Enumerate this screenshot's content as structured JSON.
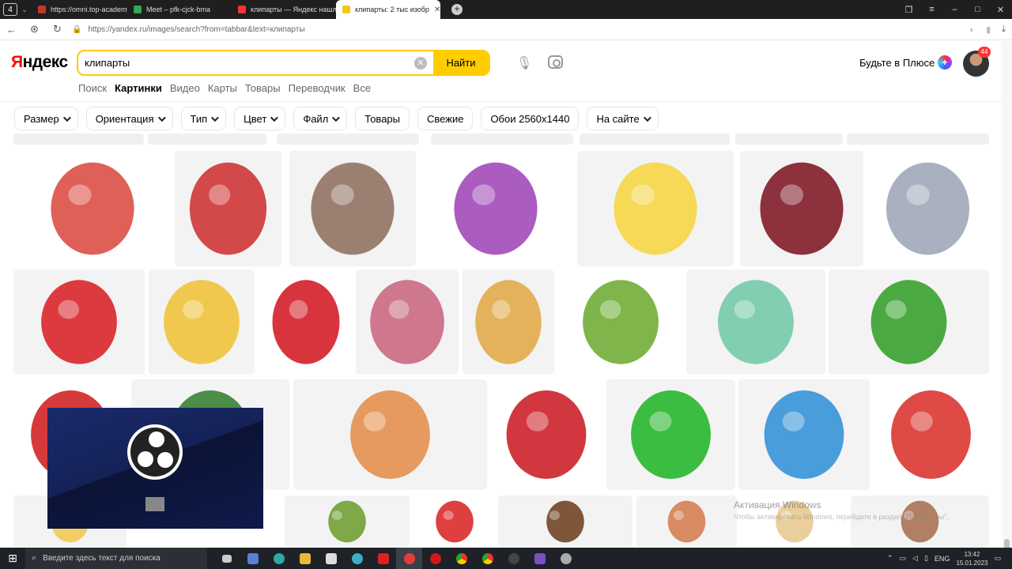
{
  "browser": {
    "tab_count": "4",
    "tabs": [
      {
        "title": "https://omni.top-academy",
        "favicon_color": "#c0392b"
      },
      {
        "title": "Meet – pfk-cjck-bma",
        "favicon_color": "#34a853"
      },
      {
        "title": "клипарты — Яндекс нашл",
        "favicon_color": "#ff3333"
      },
      {
        "title": "клипарты: 2 тыс изобр",
        "favicon_color": "#f5c518"
      }
    ],
    "url": "https://yandex.ru/images/search?from=tabbar&text=клипарты"
  },
  "header": {
    "logo_y": "Я",
    "logo_rest": "ндекс",
    "search_value": "клипарты",
    "search_button": "Найти",
    "plus_label": "Будьте в Плюсе",
    "notifications": "44"
  },
  "services": [
    "Поиск",
    "Картинки",
    "Видео",
    "Карты",
    "Товары",
    "Переводчик",
    "Все"
  ],
  "filters": [
    {
      "label": "Размер",
      "dropdown": true
    },
    {
      "label": "Ориентация",
      "dropdown": true
    },
    {
      "label": "Тип",
      "dropdown": true
    },
    {
      "label": "Цвет",
      "dropdown": true
    },
    {
      "label": "Файл",
      "dropdown": true
    },
    {
      "label": "Товары",
      "dropdown": false
    },
    {
      "label": "Свежие",
      "dropdown": false
    },
    {
      "label": "Обои 2560x1440",
      "dropdown": false
    },
    {
      "label": "На сайте",
      "dropdown": true
    }
  ],
  "images": [
    {
      "subject": "cartoon-characters-collage",
      "main_color": "#d9443a"
    },
    {
      "subject": "ice-skate-with-bow",
      "main_color": "#cc2a2a"
    },
    {
      "subject": "woman-with-flowers",
      "main_color": "#8b6b5a"
    },
    {
      "subject": "woman-in-purple-dress",
      "main_color": "#9b3fb5"
    },
    {
      "subject": "cartoon-kids-boy-and-girl",
      "main_color": "#f6d43a"
    },
    {
      "subject": "cherry",
      "main_color": "#7a0e1c"
    },
    {
      "subject": "cartoon-donkey",
      "main_color": "#9aa3b5"
    },
    {
      "subject": "red-handbag",
      "main_color": "#d8191f"
    },
    {
      "subject": "daisies",
      "main_color": "#f0c030"
    },
    {
      "subject": "red-carnations",
      "main_color": "#d0101c"
    },
    {
      "subject": "heart-of-sweets",
      "main_color": "#c7607a"
    },
    {
      "subject": "girl-with-suitcase",
      "main_color": "#e0a640"
    },
    {
      "subject": "green-sprout-with-butterfly",
      "main_color": "#69a82c"
    },
    {
      "subject": "woman-in-green-dress",
      "main_color": "#6cc7a5"
    },
    {
      "subject": "green-gift-box",
      "main_color": "#2d9b22"
    },
    {
      "subject": "red-circle",
      "main_color": "#d01818"
    },
    {
      "subject": "flower-branch",
      "main_color": "#2d7a2a"
    },
    {
      "subject": "woman-with-children",
      "main_color": "#e48a44"
    },
    {
      "subject": "white-figure-with-question-mark",
      "main_color": "#c9141c"
    },
    {
      "subject": "green-check-mark",
      "main_color": "#1ab321"
    },
    {
      "subject": "children-playing",
      "main_color": "#2a8dd6"
    },
    {
      "subject": "mushroom-gnome",
      "main_color": "#d82a26"
    },
    {
      "subject": "cartoon-girl-face",
      "main_color": "#f1c64a"
    },
    {
      "subject": "vegetable-basket",
      "main_color": "#6a9a2a"
    },
    {
      "subject": "ladybug",
      "main_color": "#d81e1e"
    },
    {
      "subject": "brown-shoe",
      "main_color": "#6a3a18"
    },
    {
      "subject": "cartoon-child",
      "main_color": "#d4784a"
    },
    {
      "subject": "blonde-girl",
      "main_color": "#e6c58a"
    },
    {
      "subject": "girl-portrait",
      "main_color": "#a46a4a"
    }
  ],
  "overlay": {
    "windows_activation": "Активация Windows",
    "windows_activation_hint": "Чтобы активировать Windows, перейдите в раздел \"Параметры\"."
  },
  "taskbar": {
    "search_placeholder": "Введите здесь текст для поиска",
    "language": "ENG",
    "time": "13:42",
    "date": "15.01.2023"
  }
}
